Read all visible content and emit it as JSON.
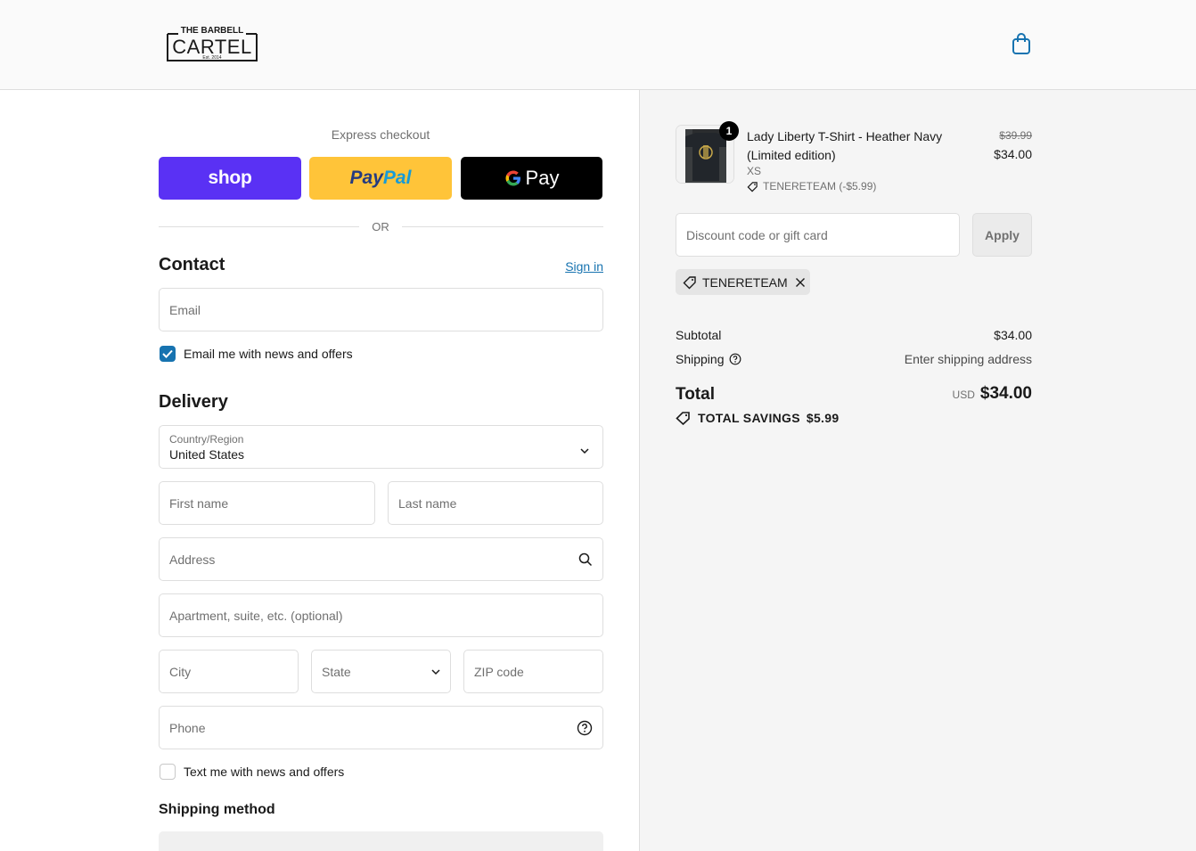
{
  "header": {
    "logo_line1": "THE BARBELL",
    "logo_line2": "CARTEL",
    "logo_line3": "Est. 2014",
    "cart_icon": "shopping-bag-icon"
  },
  "express": {
    "label": "Express checkout",
    "shop_label": "shop",
    "paypal_a": "Pay",
    "paypal_b": "Pal",
    "gpay_label": "Pay",
    "or_text": "OR"
  },
  "contact": {
    "title": "Contact",
    "signin_label": "Sign in",
    "email_placeholder": "Email",
    "news_label": "Email me with news and offers",
    "news_checked": true
  },
  "delivery": {
    "title": "Delivery",
    "country_label": "Country/Region",
    "country_value": "United States",
    "first_name": "First name",
    "last_name": "Last name",
    "address": "Address",
    "apartment": "Apartment, suite, etc. (optional)",
    "city": "City",
    "state": "State",
    "zip": "ZIP code",
    "phone": "Phone",
    "text_label": "Text me with news and offers",
    "text_checked": false
  },
  "shipping_method": {
    "title": "Shipping method"
  },
  "order": {
    "item": {
      "quantity": "1",
      "name": "Lady Liberty T-Shirt - Heather Navy (Limited edition)",
      "variant": "XS",
      "discount": "TENERETEAM (-$5.99)",
      "original_price": "$39.99",
      "price": "$34.00"
    },
    "discount_placeholder": "Discount code or gift card",
    "apply_label": "Apply",
    "applied_code": "TENERETEAM",
    "subtotal_label": "Subtotal",
    "subtotal_value": "$34.00",
    "shipping_label": "Shipping",
    "shipping_value": "Enter shipping address",
    "total_label": "Total",
    "currency": "USD",
    "total_value": "$34.00",
    "savings_label": "TOTAL SAVINGS",
    "savings_value": "$5.99"
  },
  "colors": {
    "shop_purple": "#5a31f4",
    "paypal_yellow": "#ffc439",
    "link_blue": "#1773b0"
  }
}
